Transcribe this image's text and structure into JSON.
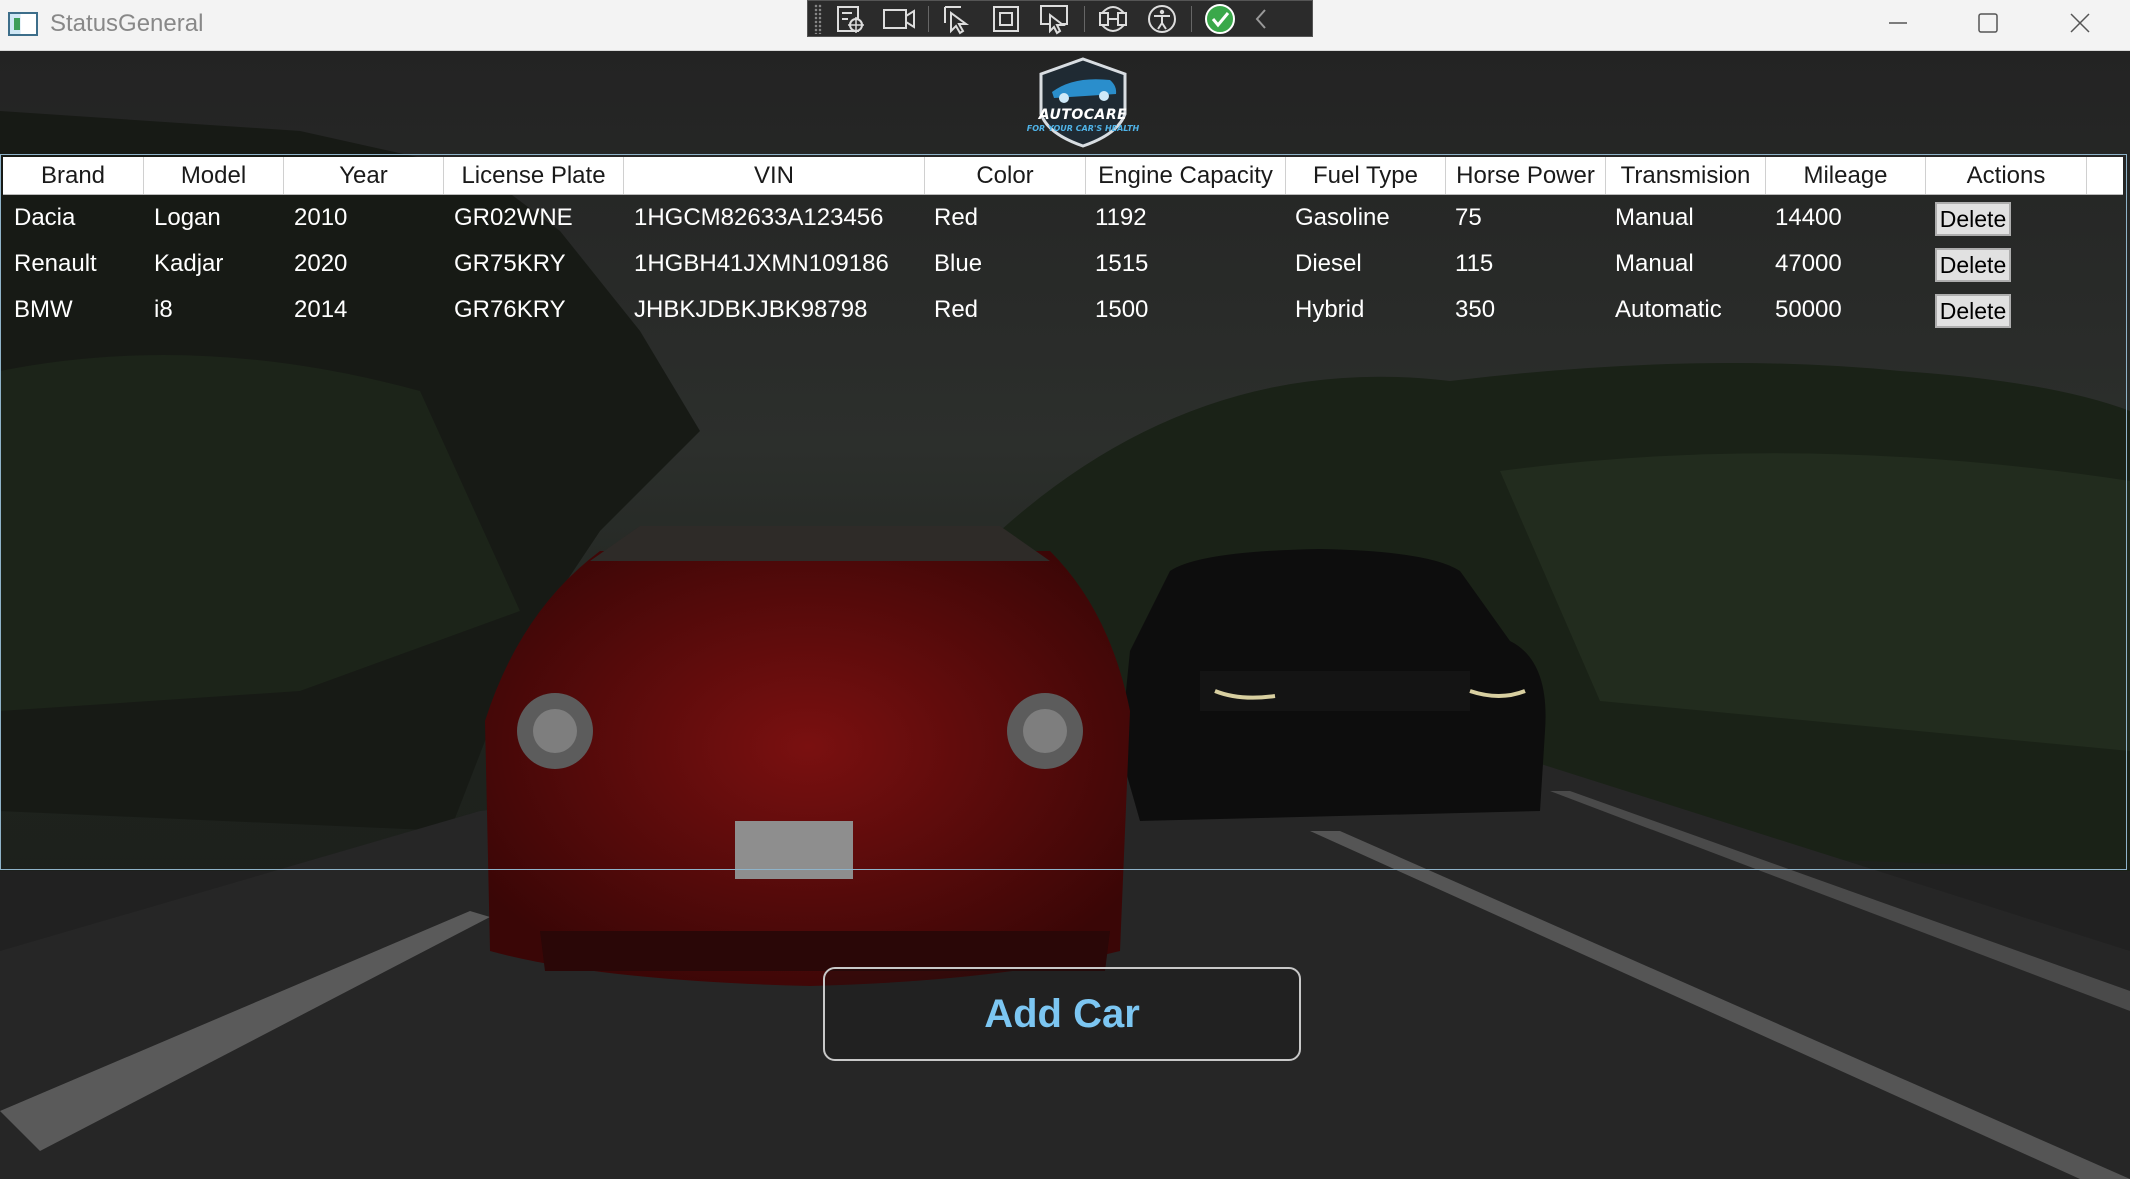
{
  "window": {
    "title": "StatusGeneral"
  },
  "toolbar": {
    "icons": [
      "select-element-icon",
      "video-camera-icon",
      "pointer-icon",
      "frame-icon",
      "display-select-icon",
      "hot-reload-icon",
      "accessibility-icon",
      "check-icon",
      "collapse-icon"
    ]
  },
  "logo": {
    "brand": "AUTOCARE",
    "tagline": "FOR YOUR CAR'S HEALTH"
  },
  "table": {
    "columns": [
      "Brand",
      "Model",
      "Year",
      "License Plate",
      "VIN",
      "Color",
      "Engine Capacity",
      "Fuel Type",
      "Horse Power",
      "Transmision",
      "Mileage",
      "Actions"
    ],
    "rows": [
      {
        "brand": "Dacia",
        "model": "Logan",
        "year": "2010",
        "plate": "GR02WNE",
        "vin": "1HGCM82633A123456",
        "color": "Red",
        "engine": "1192",
        "fuel": "Gasoline",
        "hp": "75",
        "transmission": "Manual",
        "mileage": "14400",
        "action": "Delete"
      },
      {
        "brand": "Renault",
        "model": "Kadjar",
        "year": "2020",
        "plate": "GR75KRY",
        "vin": "1HGBH41JXMN109186",
        "color": "Blue",
        "engine": "1515",
        "fuel": "Diesel",
        "hp": "115",
        "transmission": "Manual",
        "mileage": "47000",
        "action": "Delete"
      },
      {
        "brand": "BMW",
        "model": "i8",
        "year": "2014",
        "plate": "GR76KRY",
        "vin": "JHBKJDBKJBK98798",
        "color": "Red",
        "engine": "1500",
        "fuel": "Hybrid",
        "hp": "350",
        "transmission": "Automatic",
        "mileage": "50000",
        "action": "Delete"
      }
    ]
  },
  "add_button": {
    "label": "Add Car"
  },
  "colors": {
    "accent": "#7cc6f2",
    "grid_border": "#8fb3c9"
  }
}
